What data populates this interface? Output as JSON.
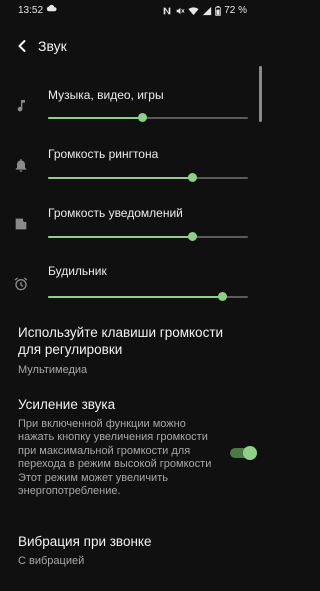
{
  "status_bar": {
    "time": "13:52",
    "cloud_icon": "cloud-icon",
    "nfc_icon": "nfc-icon",
    "mute_icon": "mute-icon",
    "wifi_icon": "wifi-icon",
    "signal_icon": "signal-icon",
    "battery_icon": "battery-icon",
    "battery": "72 %"
  },
  "header": {
    "title": "Звук",
    "back_icon": "arrow-back-icon"
  },
  "volumes": [
    {
      "label": "Музыка, видео, игры",
      "icon": "music-note-icon",
      "level": 0.47
    },
    {
      "label": "Громкость рингтона",
      "icon": "bell-icon",
      "level": 0.72
    },
    {
      "label": "Громкость уведомлений",
      "icon": "notification-icon",
      "level": 0.72
    },
    {
      "label": "Будильник",
      "icon": "alarm-icon",
      "level": 0.87
    }
  ],
  "volume_keys": {
    "title": "Используйте клавиши громкости для регулировки",
    "summary": "Мультимедиа"
  },
  "sound_boost": {
    "title": "Усиление звука",
    "summary": "При включенной функции можно нажать кнопку увеличения громкости при максимальной громкости для перехода в режим высокой громкости Этот режим может увеличить энергопотребление.",
    "enabled": true
  },
  "ring_vibration": {
    "title": "Вибрация при звонке",
    "summary": "С вибрацией"
  },
  "colors": {
    "accent": "#8fcf8a",
    "background": "#101010"
  }
}
